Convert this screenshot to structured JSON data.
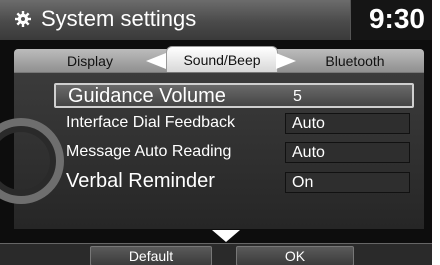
{
  "header": {
    "title": "System settings",
    "clock": "9:30",
    "icon": "gear-icon"
  },
  "tabs": [
    {
      "label": "Display",
      "active": false
    },
    {
      "label": "Sound/Beep",
      "active": true
    },
    {
      "label": "Bluetooth",
      "active": false
    }
  ],
  "settings": [
    {
      "label": "Guidance Volume",
      "value": "5",
      "selected": true
    },
    {
      "label": "Interface Dial Feedback",
      "value": "Auto",
      "selected": false
    },
    {
      "label": "Message Auto Reading",
      "value": "Auto",
      "selected": false
    },
    {
      "label": "Verbal Reminder",
      "value": "On",
      "selected": false
    }
  ],
  "footer": {
    "default_label": "Default",
    "ok_label": "OK"
  },
  "colors": {
    "background": "#0d0d0d",
    "header": "#4a4a4a",
    "selected_border": "#cfcfcf"
  }
}
